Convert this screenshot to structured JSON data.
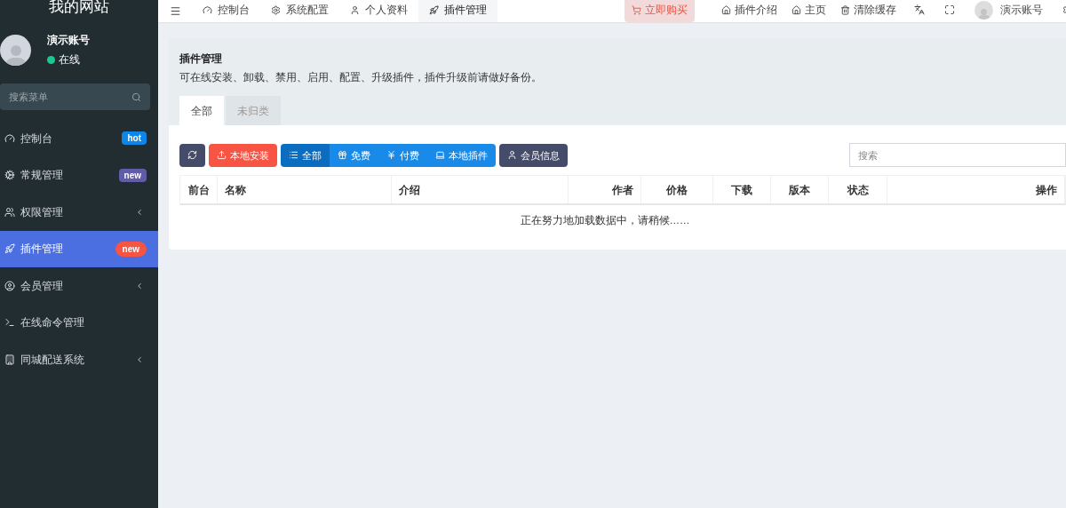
{
  "sidebar": {
    "logo": "我的网站",
    "user": {
      "name": "演示账号",
      "status": "在线"
    },
    "search": {
      "placeholder": "搜索菜单"
    },
    "items": [
      {
        "label": "控制台",
        "selected": false,
        "badge": {
          "text": "hot",
          "color": "#0f86e5",
          "kind": "square"
        }
      },
      {
        "label": "常规管理",
        "selected": false,
        "badge": {
          "text": "new",
          "color": "#605ca8",
          "kind": "square"
        }
      },
      {
        "label": "权限管理",
        "selected": false,
        "expandable": true
      },
      {
        "label": "插件管理",
        "selected": true,
        "badge": {
          "text": "new",
          "color": "#f75444",
          "kind": "pill"
        }
      },
      {
        "label": "会员管理",
        "selected": false,
        "expandable": true
      },
      {
        "label": "在线命令管理",
        "selected": false
      },
      {
        "label": "同城配送系统",
        "selected": false,
        "expandable": true
      }
    ]
  },
  "top_tabs": [
    {
      "label": "控制台",
      "selected": false
    },
    {
      "label": "系统配置",
      "selected": false
    },
    {
      "label": "个人资料",
      "selected": false
    },
    {
      "label": "插件管理",
      "selected": true
    }
  ],
  "top_right": {
    "buy_button": "立即购买",
    "links": [
      "插件介绍",
      "主页",
      "清除缓存"
    ],
    "user": "演示账号"
  },
  "panel": {
    "title": "插件管理",
    "description": "可在线安装、卸载、禁用、启用、配置、升级插件，插件升级前请做好备份。",
    "tabs": [
      {
        "label": "全部",
        "selected": true
      },
      {
        "label": "未归类",
        "selected": false
      }
    ],
    "install_button": "本地安装",
    "filters": [
      {
        "label": "全部",
        "selected": true
      },
      {
        "label": "免费",
        "selected": false
      },
      {
        "label": "付费",
        "selected": false
      },
      {
        "label": "本地插件",
        "selected": false
      }
    ],
    "member_button": "会员信息",
    "search": {
      "placeholder": "搜索"
    },
    "table": {
      "columns": [
        "前台",
        "名称",
        "介绍",
        "作者",
        "价格",
        "下载",
        "版本",
        "状态",
        "操作"
      ],
      "empty_message": "正在努力地加载数据中，请稍候……"
    }
  }
}
